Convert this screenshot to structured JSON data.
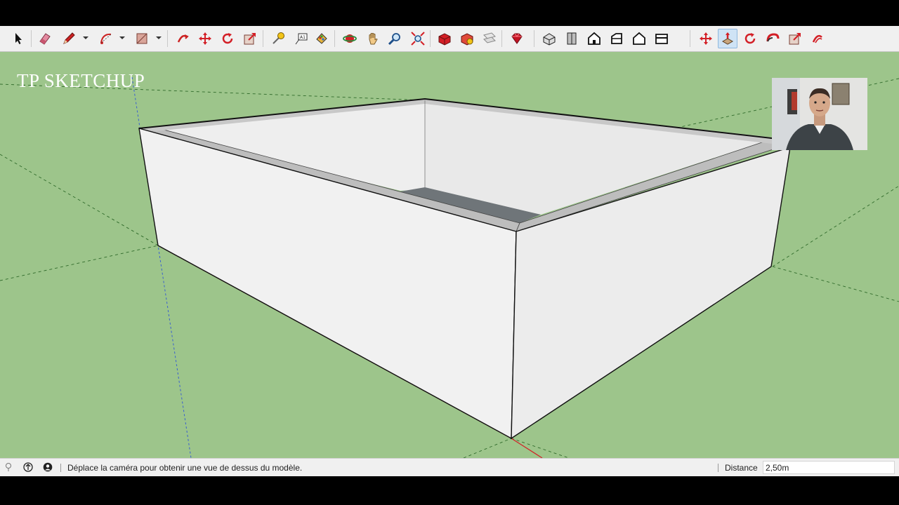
{
  "watermark": {
    "title": "TP SKETCHUP"
  },
  "toolbar": {
    "tools": [
      {
        "icon": "select-icon"
      },
      {
        "icon": "eraser-icon"
      },
      {
        "icon": "pencil-icon"
      },
      {
        "icon": "arc-icon"
      },
      {
        "icon": "rectangle-icon"
      },
      {
        "icon": "push-pull-icon"
      },
      {
        "icon": "move-icon"
      },
      {
        "icon": "rotate-icon"
      },
      {
        "icon": "scale-icon"
      },
      {
        "icon": "tape-measure-icon"
      },
      {
        "icon": "text-icon"
      },
      {
        "icon": "paint-bucket-icon"
      },
      {
        "icon": "orbit-icon"
      },
      {
        "icon": "pan-icon"
      },
      {
        "icon": "zoom-icon"
      },
      {
        "icon": "zoom-extents-icon"
      },
      {
        "icon": "warehouse-icon"
      },
      {
        "icon": "extension-warehouse-icon"
      },
      {
        "icon": "layout-icon"
      },
      {
        "icon": "ruby-icon"
      },
      {
        "icon": "iso-view-icon"
      },
      {
        "icon": "top-view-icon"
      },
      {
        "icon": "front-view-icon"
      },
      {
        "icon": "right-view-icon"
      },
      {
        "icon": "back-view-icon"
      },
      {
        "icon": "left-view-icon"
      },
      {
        "icon": "move-icon"
      },
      {
        "icon": "push-pull-icon"
      },
      {
        "icon": "rotate-icon"
      },
      {
        "icon": "follow-me-icon"
      },
      {
        "icon": "scale-icon"
      },
      {
        "icon": "offset-icon"
      }
    ],
    "active_tool": "push-pull-icon"
  },
  "statusbar": {
    "message": "Déplace la caméra pour obtenir une vue de dessus du modèle.",
    "distance_label": "Distance",
    "distance_value": "2,50m"
  },
  "colors": {
    "ground": "#9dc58b",
    "wall_face": "#f2f2f2",
    "wall_top": "#b9b9b9",
    "floor_strip": "#6f7579",
    "accent_red": "#d31f26"
  }
}
